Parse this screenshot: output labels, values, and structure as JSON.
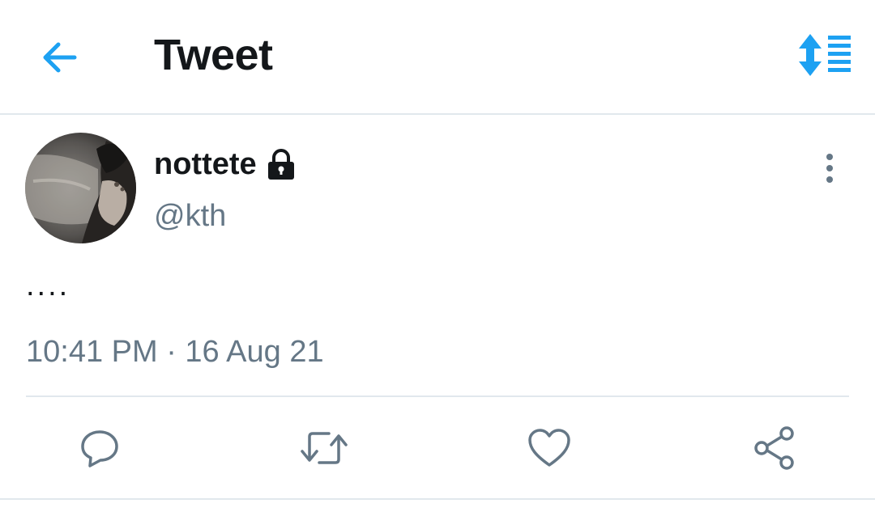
{
  "header": {
    "title": "Tweet",
    "back_icon": "arrow-left-icon",
    "sort_icon": "sort-lines-icon"
  },
  "tweet": {
    "author": {
      "display_name": "nottete",
      "handle": "@kth",
      "protected_icon": "lock-icon",
      "avatar": "profile-photo"
    },
    "text": "....",
    "timestamp": "10:41 PM · 16 Aug 21",
    "more_icon": "more-vertical-icon"
  },
  "actions": [
    {
      "name": "reply",
      "icon": "reply-icon"
    },
    {
      "name": "retweet",
      "icon": "retweet-icon"
    },
    {
      "name": "like",
      "icon": "heart-icon"
    },
    {
      "name": "share",
      "icon": "share-icon"
    }
  ],
  "colors": {
    "accent": "#1da1f2",
    "text_primary": "#14171a",
    "text_secondary": "#657786",
    "border": "#e1e8ed"
  }
}
